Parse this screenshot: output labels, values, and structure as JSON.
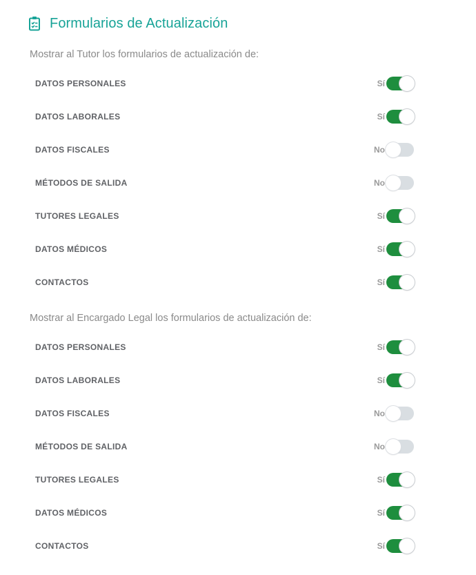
{
  "header": {
    "title": "Formularios de Actualización",
    "icon": "clipboard-check-icon"
  },
  "colors": {
    "accent": "#17a397",
    "toggle_on": "#1e8e3e",
    "toggle_off": "#d9dee2"
  },
  "sections": [
    {
      "subtitle": "Mostrar al Tutor los formularios de actualización de:",
      "items": [
        {
          "label": "DATOS PERSONALES",
          "state": "Sí",
          "on": true
        },
        {
          "label": "DATOS LABORALES",
          "state": "Sí",
          "on": true
        },
        {
          "label": "DATOS FISCALES",
          "state": "No",
          "on": false
        },
        {
          "label": "MÉTODOS DE SALIDA",
          "state": "No",
          "on": false
        },
        {
          "label": "TUTORES LEGALES",
          "state": "Sí",
          "on": true
        },
        {
          "label": "DATOS MÉDICOS",
          "state": "Sí",
          "on": true
        },
        {
          "label": "CONTACTOS",
          "state": "Sí",
          "on": true
        }
      ]
    },
    {
      "subtitle": "Mostrar al Encargado Legal los formularios de actualización de:",
      "items": [
        {
          "label": "DATOS PERSONALES",
          "state": "Sí",
          "on": true
        },
        {
          "label": "DATOS LABORALES",
          "state": "Sí",
          "on": true
        },
        {
          "label": "DATOS FISCALES",
          "state": "No",
          "on": false
        },
        {
          "label": "MÉTODOS DE SALIDA",
          "state": "No",
          "on": false
        },
        {
          "label": "TUTORES LEGALES",
          "state": "Sí",
          "on": true
        },
        {
          "label": "DATOS MÉDICOS",
          "state": "Sí",
          "on": true
        },
        {
          "label": "CONTACTOS",
          "state": "Sí",
          "on": true
        }
      ]
    }
  ]
}
